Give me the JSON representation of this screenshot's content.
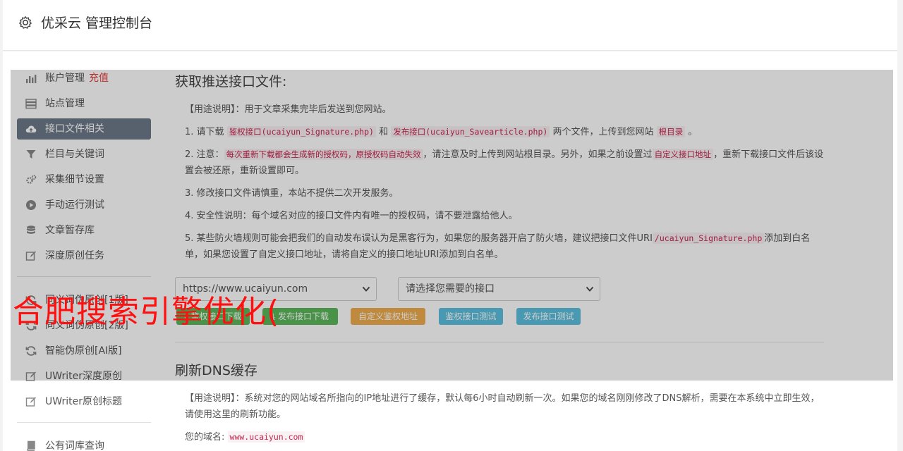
{
  "header": {
    "title": "优采云 管理控制台"
  },
  "sidebar": {
    "items": [
      {
        "label": "账户管理",
        "extra": "充值",
        "icon": "bar-chart-icon"
      },
      {
        "label": "站点管理",
        "icon": "server-icon"
      },
      {
        "label": "接口文件相关",
        "icon": "cloud-upload-icon",
        "active": true
      },
      {
        "label": "栏目与关键词",
        "icon": "filter-icon"
      },
      {
        "label": "采集细节设置",
        "icon": "cogs-icon"
      },
      {
        "label": "手动运行测试",
        "icon": "play-circle-icon"
      },
      {
        "label": "文章暂存库",
        "icon": "database-icon"
      },
      {
        "label": "深度原创任务",
        "icon": "edit-icon"
      }
    ],
    "items2": [
      {
        "label": "同义词伪原创[1版]",
        "icon": "refresh-icon"
      },
      {
        "label": "同义词伪原创[2版]",
        "icon": "refresh-icon"
      },
      {
        "label": "智能伪原创[AI版]",
        "icon": "refresh-icon"
      },
      {
        "label": "UWriter深度原创",
        "icon": "edit-icon"
      },
      {
        "label": "UWriter原创标题",
        "icon": "edit-icon"
      }
    ],
    "items3": [
      {
        "label": "公有词库查询",
        "icon": "book-icon"
      }
    ]
  },
  "push": {
    "title": "获取推送接口文件:",
    "usage_label": "【用途说明】",
    "usage_text": "：用于文章采集完毕后发送到您网站。",
    "p1_a": "1. 请下载",
    "p1_code1": "鉴权接口(ucaiyun_Signature.php)",
    "p1_b": "和",
    "p1_code2": "发布接口(ucaiyun_Savearticle.php)",
    "p1_c": "两个文件，上传到您网站",
    "p1_code3": "根目录",
    "p1_d": "。",
    "p2_a": "2. 注意：",
    "p2_code1": "每次重新下载都会生成新的授权码，原授权码自动失效",
    "p2_b": "，请注意及时上传到网站根目录。另外，如果之前设置过",
    "p2_code2": "自定义接口地址",
    "p2_c": "，重新下载接口文件后该设置会被还原，重新设置即可。",
    "p3": "3. 修改接口文件请慎重，本站不提供二次开发服务。",
    "p4": "4. 安全性说明：每个域名对应的接口文件内有唯一的授权码，请不要泄露给他人。",
    "p5_a": "5. 某些防火墙规则可能会把我们的自动发布误认为是黑客行为，如果您的服务器开启了防火墙，建议把接口文件URI",
    "p5_code": "/ucaiyun_Signature.php",
    "p5_b": "添加到白名单，如果您设置了自定义接口地址，请将自定义的接口地址URI添加到白名单。",
    "site_select": "https://www.ucaiyun.com",
    "api_select": "请选择您需要的接口",
    "btn1": "鉴权接口下载",
    "btn2": "发布接口下载",
    "btn3": "自定义鉴权地址",
    "btn4": "鉴权接口测试",
    "btn5": "发布接口测试"
  },
  "dns": {
    "title": "刷新DNS缓存",
    "usage_label": "【用途说明】",
    "usage_text": "：系统对您的网站域名所指向的IP地址进行了缓存，默认每6小时自动刷新一次。如果您的域名刚刚修改了DNS解析，需要在本系统中立即生效，请使用这里的刷新功能。",
    "domain_label": "您的域名:",
    "domain_value": "www.ucaiyun.com"
  },
  "watermark": {
    "text": "合肥搜索引擎优化("
  },
  "colors": {
    "active_nav": "#6c7a89",
    "recharge": "#e53935",
    "watermark": "#ff1010",
    "code": "#c7254e"
  }
}
